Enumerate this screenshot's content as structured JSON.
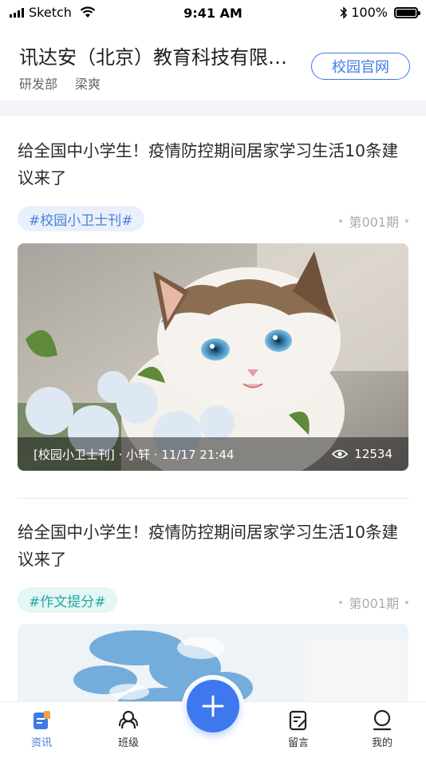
{
  "status_bar": {
    "carrier": "Sketch",
    "time": "9:41 AM",
    "battery": "100%"
  },
  "header": {
    "org_name": "讯达安（北京）教育科技有限公司",
    "department": "研发部",
    "user": "梁爽",
    "site_button": "校园官网"
  },
  "articles": [
    {
      "title": "给全国中小学生！疫情防控期间居家学习生活10条建议来了",
      "tag": "#校园小卫士刊#",
      "issue": "第001期",
      "meta": "[校园小卫士刊] · 小轩 · 11/17 21:44",
      "views": "12534"
    },
    {
      "title": "给全国中小学生！疫情防控期间居家学习生活10条建议来了",
      "tag": "#作文提分#",
      "issue": "第001期"
    }
  ],
  "tabbar": {
    "items": [
      {
        "label": "资讯",
        "icon": "news-icon"
      },
      {
        "label": "班级",
        "icon": "class-icon"
      },
      {
        "label": "留言",
        "icon": "message-icon"
      },
      {
        "label": "我的",
        "icon": "profile-icon"
      }
    ],
    "active": "资讯",
    "fab_icon": "plus-icon"
  },
  "colors": {
    "accent": "#3f7be6",
    "tag_blue_bg": "#e9f0fb",
    "tag_teal_bg": "#e4f6f5",
    "tag_teal_text": "#23a8a2"
  }
}
